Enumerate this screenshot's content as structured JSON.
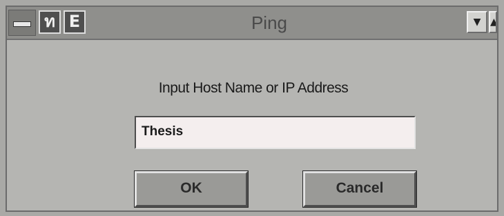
{
  "window": {
    "title": "Ping"
  },
  "titlebar": {
    "icon1_glyph": "ท",
    "icon2_glyph": "E",
    "minimize_glyph": "▼",
    "maximize_glyph": "▲"
  },
  "dialog": {
    "prompt": "Input Host Name or IP Address",
    "host_value": "Thesis",
    "ok_label": "OK",
    "cancel_label": "Cancel"
  }
}
